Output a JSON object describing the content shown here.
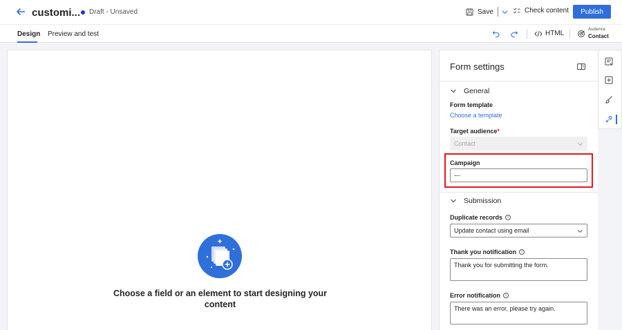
{
  "header": {
    "title": "customi...",
    "status": "Draft - Unsaved",
    "save_label": "Save",
    "check_label": "Check content",
    "publish_label": "Publish"
  },
  "tabs": {
    "design": "Design",
    "preview": "Preview and test",
    "html_label": "HTML",
    "audience_label": "Audience",
    "audience_value": "Contact"
  },
  "canvas": {
    "empty_text": "Choose a field or an element to start designing your content"
  },
  "panel": {
    "title": "Form settings",
    "general": "General",
    "form_template_label": "Form template",
    "form_template_link": "Choose a template",
    "target_audience_label": "Target audience",
    "required_mark": "*",
    "target_audience_value": "Contact",
    "campaign_label": "Campaign",
    "campaign_value": "---",
    "submission": "Submission",
    "duplicate_label": "Duplicate records",
    "duplicate_value": "Update contact using email",
    "thankyou_label": "Thank you notification",
    "thankyou_value": "Thank you for submitting the form.",
    "error_label": "Error notification",
    "error_value": "There was an error, please try again.",
    "info_glyph": "i"
  },
  "colors": {
    "accent": "#2f6fdb",
    "highlight": "#e8141e",
    "draft_dot": "#2b2bd9"
  }
}
